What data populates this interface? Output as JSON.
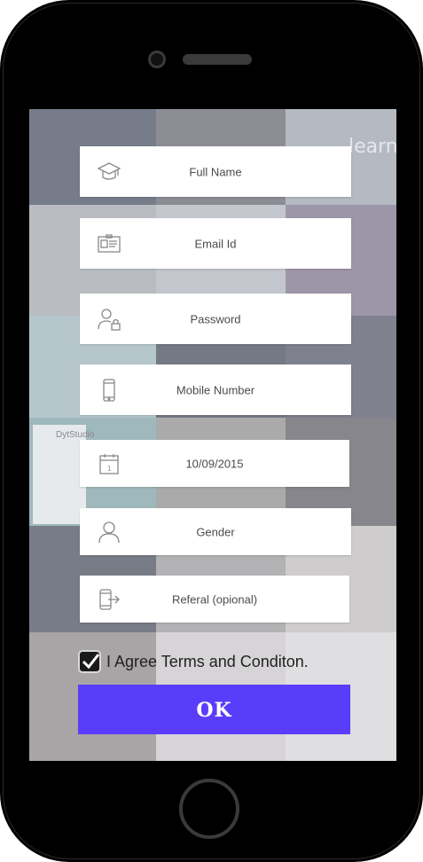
{
  "form": {
    "fields": [
      {
        "label": "Full Name",
        "icon": "graduation-cap-icon"
      },
      {
        "label": "Email Id",
        "icon": "id-card-icon"
      },
      {
        "label": "Password",
        "icon": "user-lock-icon"
      },
      {
        "label": "Mobile Number",
        "icon": "mobile-phone-icon"
      },
      {
        "label": "10/09/2015",
        "icon": "calendar-icon"
      },
      {
        "label": "Gender",
        "icon": "user-icon"
      },
      {
        "label": "Referal (opional)",
        "icon": "phone-share-icon"
      }
    ],
    "agree_label": "I Agree Terms and Conditon.",
    "agree_checked": true,
    "submit_label": "OK"
  },
  "background": {
    "photo_text": "learn.",
    "app_card_title": "DytStudio"
  },
  "colors": {
    "button": "#5a3dfa",
    "field_bg": "#ffffff",
    "phone_body": "#000000"
  }
}
